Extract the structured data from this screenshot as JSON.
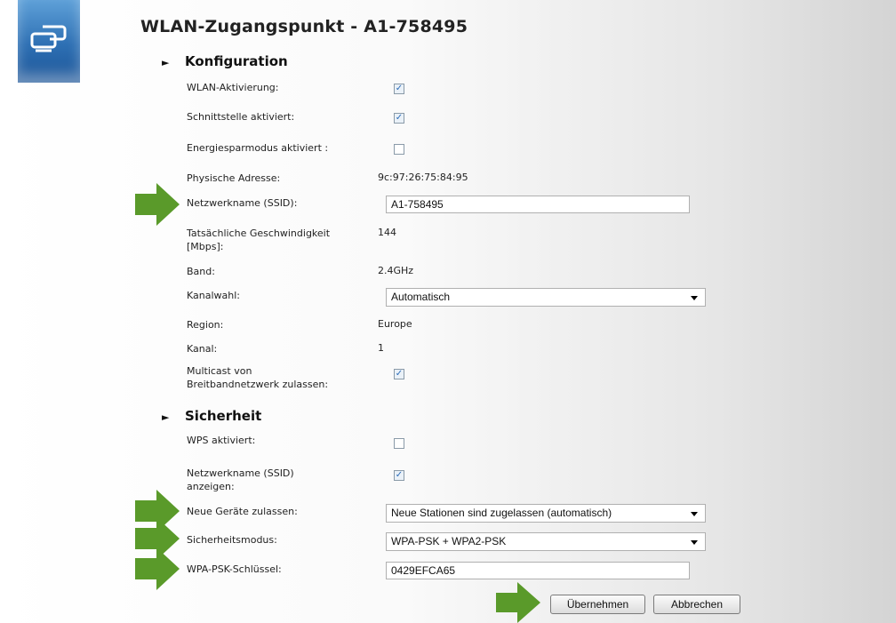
{
  "page": {
    "title": "WLAN-Zugangspunkt - A1-758495",
    "accent_arrow_color": "#5a9a2a",
    "logo_icon": "network-device-icon"
  },
  "konfiguration": {
    "heading": "Konfiguration",
    "wlan_aktivierung": {
      "label": "WLAN-Aktivierung:",
      "checked": true
    },
    "schnittstelle": {
      "label": "Schnittstelle aktiviert:",
      "checked": true
    },
    "energiesparmodus": {
      "label": "Energiesparmodus aktiviert :",
      "checked": false
    },
    "physische_adresse": {
      "label": "Physische Adresse:",
      "value": "9c:97:26:75:84:95"
    },
    "ssid": {
      "label": "Netzwerkname (SSID):",
      "value": "A1-758495"
    },
    "geschwindigkeit": {
      "label_line1": "Tatsächliche Geschwindigkeit",
      "label_line2": "[Mbps]:",
      "value": "144"
    },
    "band": {
      "label": "Band:",
      "value": "2.4GHz"
    },
    "kanalwahl": {
      "label": "Kanalwahl:",
      "value": "Automatisch"
    },
    "region": {
      "label": "Region:",
      "value": "Europe"
    },
    "kanal": {
      "label": "Kanal:",
      "value": "1"
    },
    "multicast": {
      "label_line1": "Multicast von",
      "label_line2": "Breitbandnetzwerk zulassen:",
      "checked": true
    }
  },
  "sicherheit": {
    "heading": "Sicherheit",
    "wps": {
      "label": "WPS aktiviert:",
      "checked": false
    },
    "ssid_anzeigen": {
      "label_line1": "Netzwerkname (SSID)",
      "label_line2": "anzeigen:",
      "checked": true
    },
    "neue_geraete": {
      "label": "Neue Geräte zulassen:",
      "value": "Neue Stationen sind zugelassen (automatisch)"
    },
    "sicherheitsmodus": {
      "label": "Sicherheitsmodus:",
      "value": "WPA-PSK + WPA2-PSK"
    },
    "psk": {
      "label": "WPA-PSK-Schlüssel:",
      "value": "0429EFCA65"
    }
  },
  "buttons": {
    "apply": "Übernehmen",
    "cancel": "Abbrechen"
  }
}
